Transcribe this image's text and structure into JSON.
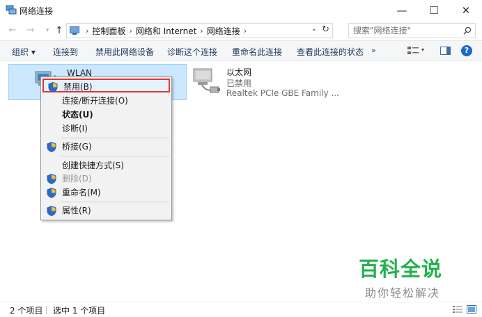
{
  "window": {
    "title": "网络连接",
    "minimize": "—",
    "maximize": "☐",
    "close": "✕"
  },
  "nav": {
    "back": "←",
    "forward": "→",
    "recent": "▾",
    "up": "↑"
  },
  "address": {
    "crumbs": [
      "控制面板",
      "网络和 Internet",
      "网络连接"
    ],
    "separator": "›",
    "dropdown": "⌄",
    "refresh": "↻"
  },
  "search": {
    "placeholder": "搜索\"网络连接\"",
    "icon": "search-icon"
  },
  "toolbar": {
    "organize": "组织 ▾",
    "connect": "连接到",
    "disable": "禁用此网络设备",
    "diagnose": "诊断这个连接",
    "rename": "重命名此连接",
    "status": "查看此连接的状态",
    "more": "»",
    "views_dd": "▾",
    "help": "?"
  },
  "items": {
    "wlan": {
      "name": "WLAN"
    },
    "ethernet": {
      "name": "以太网",
      "status": "已禁用",
      "device": "Realtek PCIe GBE Family ..."
    }
  },
  "context_menu": {
    "disable": "禁用(B)",
    "connect": "连接/断开连接(O)",
    "status": "状态(U)",
    "diagnose": "诊断(I)",
    "bridge": "桥接(G)",
    "shortcut": "创建快捷方式(S)",
    "delete": "删除(D)",
    "rename": "重命名(M)",
    "properties": "属性(R)"
  },
  "watermark": {
    "title": "百科全说",
    "subtitle": "助你轻松解决"
  },
  "statusbar": {
    "count": "2 个项目",
    "selected": "选中 1 个项目"
  },
  "colors": {
    "selection": "#cce8ff",
    "highlight_border": "#e03434",
    "toolbar_text": "#1e395b",
    "watermark_green": "#23b14d"
  }
}
